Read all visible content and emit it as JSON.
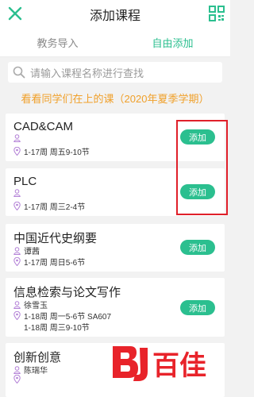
{
  "header": {
    "title": "添加课程",
    "close_icon": "close-icon",
    "scan_icon": "qr-scan-icon"
  },
  "tabs": [
    {
      "label": "教务导入",
      "active": false
    },
    {
      "label": "自由添加",
      "active": true
    }
  ],
  "search": {
    "placeholder": "请输入课程名称进行查找",
    "icon": "search-icon"
  },
  "hint": "看看同学们在上的课（2020年夏季学期）",
  "add_label": "添加",
  "courses": [
    {
      "name": "CAD&CAM",
      "teacher": "",
      "schedule": [
        "1-17周 周五9-10节"
      ]
    },
    {
      "name": "PLC",
      "teacher": "",
      "schedule": [
        "1-17周 周三2-4节"
      ]
    },
    {
      "name": "中国近代史纲要",
      "teacher": "谭茜",
      "schedule": [
        "1-17周 周日5-6节"
      ]
    },
    {
      "name": "信息检索与论文写作",
      "teacher": "徐雪玉",
      "schedule": [
        "1-18周 周一5-6节 SA607",
        "1-18周 周三9-10节"
      ]
    },
    {
      "name": "创新创意",
      "teacher": "陈瑞华",
      "schedule": []
    }
  ],
  "watermark": {
    "text": "百佳",
    "logo_color": "#e8232a"
  },
  "colors": {
    "accent": "#2bbf8f",
    "hint": "#f0a02a",
    "highlight": "#e0202a"
  }
}
